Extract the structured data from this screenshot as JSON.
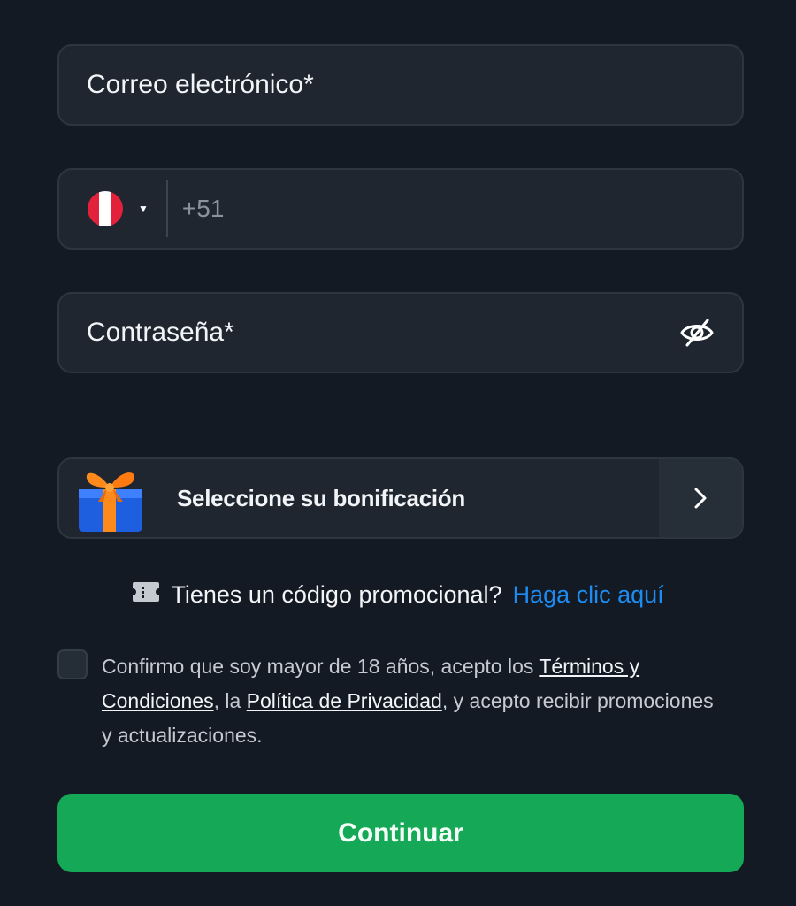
{
  "email": {
    "label": "Correo electrónico*"
  },
  "phone": {
    "country_flag": "peru-flag-icon",
    "dial_code": "+51"
  },
  "password": {
    "label": "Contraseña*",
    "toggle_icon": "eye-slash-icon"
  },
  "bonus": {
    "label": "Seleccione su bonificación",
    "icon": "gift-icon",
    "arrow_icon": "chevron-right-icon"
  },
  "promo": {
    "icon": "ticket-icon",
    "text": "Tienes un código promocional?",
    "link": "Haga clic aquí"
  },
  "consent": {
    "text_1": "Confirmo que soy mayor de 18 años, acepto los ",
    "terms_link": "Términos y Condiciones",
    "text_2": ", la ",
    "privacy_link": "Política de Privacidad",
    "text_3": ", y acepto recibir promociones y actualizaciones."
  },
  "continue_button": {
    "label": "Continuar"
  },
  "colors": {
    "background": "#131a24",
    "field": "#1f2630",
    "accent_link": "#1d8bf0",
    "primary_button": "#15a857"
  }
}
